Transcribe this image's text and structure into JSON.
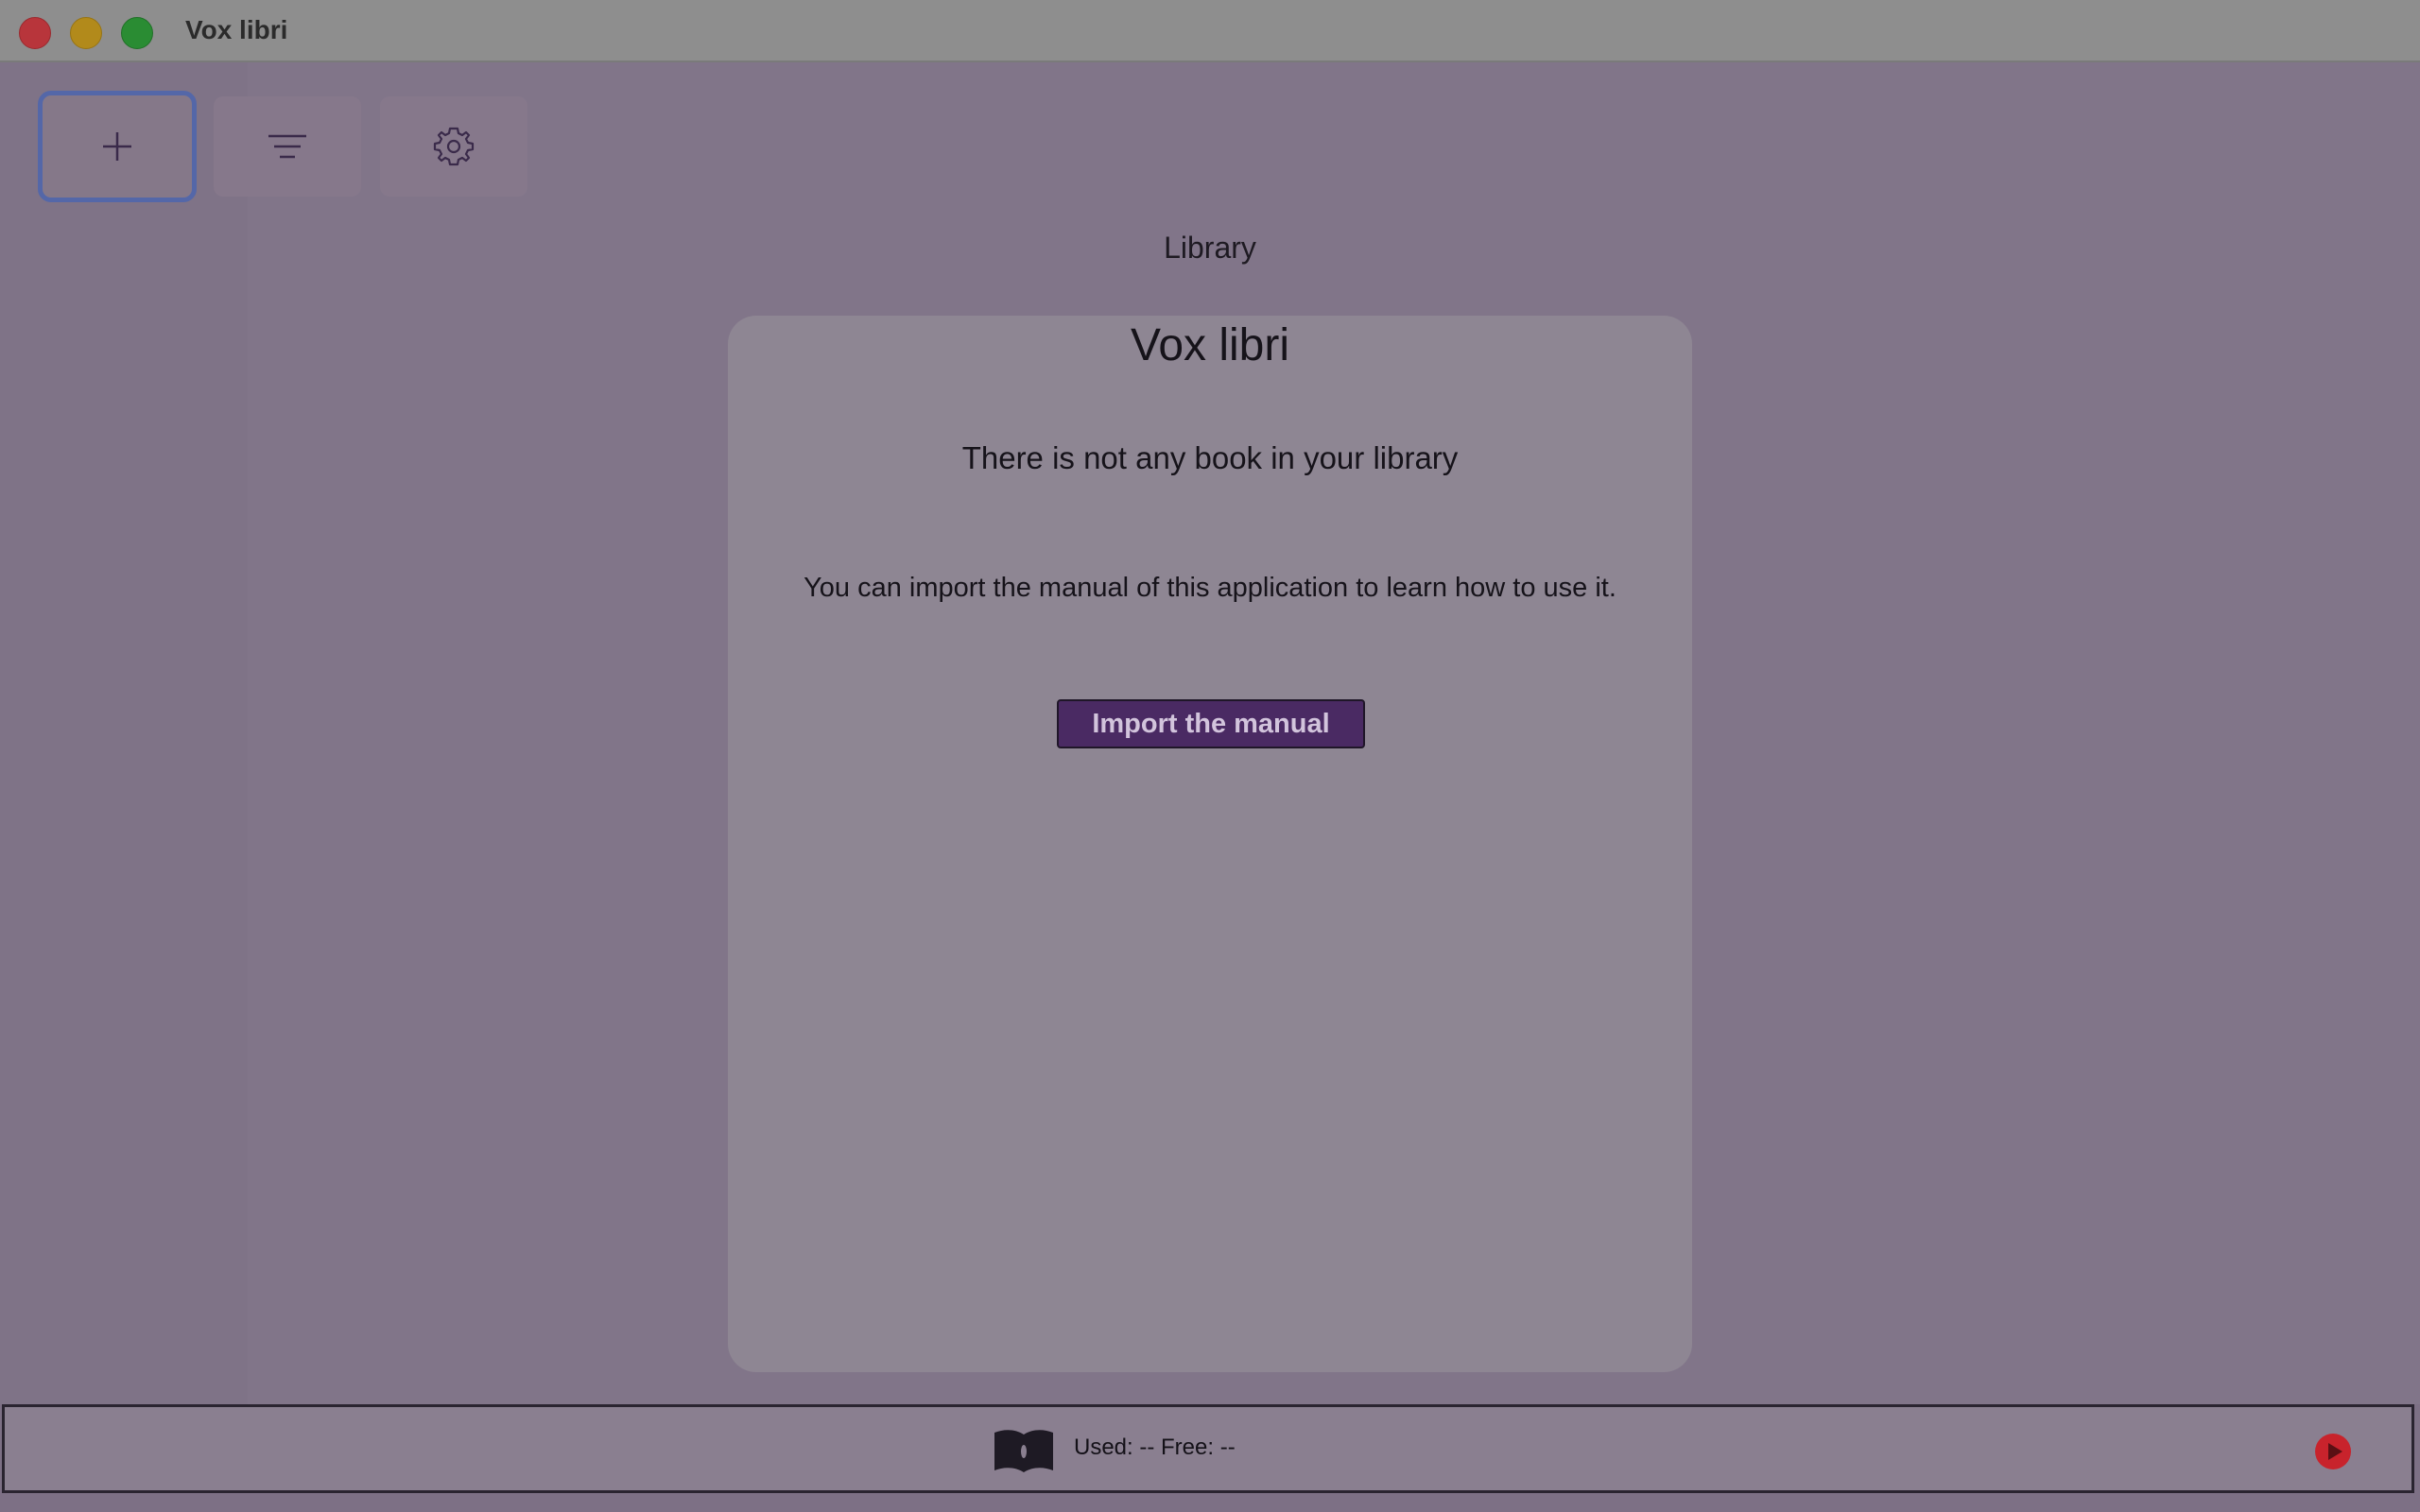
{
  "window": {
    "title": "Vox libri"
  },
  "toolbar": {
    "add_icon": "plus-icon",
    "sort_icon": "sort-lines-icon",
    "settings_icon": "gear-icon"
  },
  "library": {
    "heading": "Library"
  },
  "card": {
    "title": "Vox libri",
    "empty_message": "There is not any book in your library",
    "hint": "You can import the manual of this application to learn how to use it.",
    "import_button": "Import the manual"
  },
  "status": {
    "storage": "Used: -- Free: --",
    "book_icon": "open-book-icon",
    "play_icon": "play-icon"
  },
  "colors": {
    "accent": "#4a2a63",
    "focus_ring": "#5467a8",
    "play": "#c8232c"
  }
}
